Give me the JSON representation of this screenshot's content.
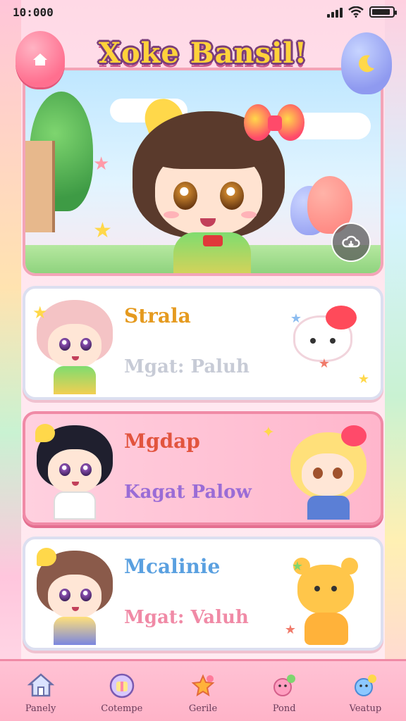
{
  "status_bar": {
    "time": "10:000",
    "battery_level": 0.9,
    "icons": [
      "signal-icon",
      "wifi-icon",
      "battery-icon"
    ]
  },
  "header": {
    "title": "Xoke Bansil!",
    "left_button_icon": "home-balloon-icon",
    "right_button_icon": "moon-balloon-icon"
  },
  "hero": {
    "action_icon": "cloud-download-icon"
  },
  "cards": [
    {
      "title": "Strala",
      "subtitle": "Mgat: Paluh",
      "title_color": "#e59a1f",
      "subtitle_color": "#c7cbd6",
      "style": "white"
    },
    {
      "title": "Mgdap",
      "subtitle": "Kagat Palow",
      "title_color": "#e2543e",
      "subtitle_color": "#9a6cd6",
      "style": "pink"
    },
    {
      "title": "Mcalinie",
      "subtitle": "Mgat: Valuh",
      "title_color": "#5aa0e0",
      "subtitle_color": "#f08aa6",
      "style": "white"
    }
  ],
  "nav": {
    "items": [
      {
        "label": "Panely",
        "icon": "home-icon"
      },
      {
        "label": "Cotempe",
        "icon": "gift-icon"
      },
      {
        "label": "Gerile",
        "icon": "star-bow-icon"
      },
      {
        "label": "Pond",
        "icon": "bunny-icon"
      },
      {
        "label": "Veatup",
        "icon": "bear-icon"
      }
    ]
  },
  "colors": {
    "accent_pink": "#f08aa6",
    "title_yellow": "#ffd23a",
    "title_outline": "#7a3e7a"
  }
}
